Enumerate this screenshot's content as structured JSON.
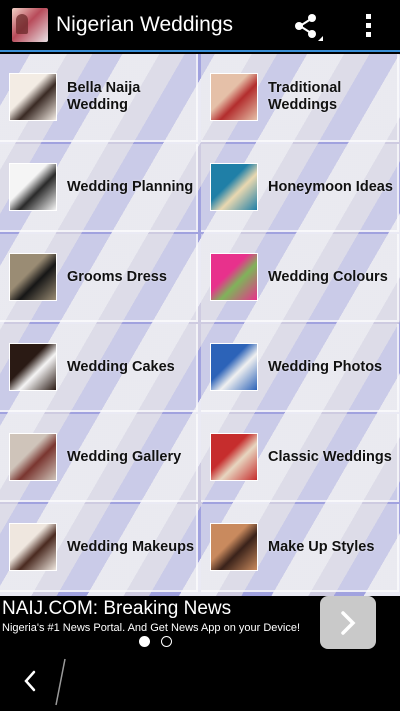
{
  "app": {
    "title": "Nigerian Weddings",
    "icon": "app-logo-icon"
  },
  "toolbar": {
    "share_icon": "share-icon",
    "overflow_icon": "overflow-menu-icon"
  },
  "categories": [
    {
      "label": "Bella Naija Wedding",
      "thumb_colors": [
        "#f3ece4",
        "#3a2a24"
      ]
    },
    {
      "label": "Traditional Weddings",
      "thumb_colors": [
        "#e5c0a8",
        "#b32d2d"
      ]
    },
    {
      "label": "Wedding Planning",
      "thumb_colors": [
        "#f5f5f5",
        "#2a2a2a"
      ]
    },
    {
      "label": "Honeymoon Ideas",
      "thumb_colors": [
        "#1f7fa7",
        "#e9d8b0"
      ]
    },
    {
      "label": "Grooms Dress",
      "thumb_colors": [
        "#9a8c74",
        "#161616"
      ]
    },
    {
      "label": "Wedding Colours",
      "thumb_colors": [
        "#e8318c",
        "#7fb35a"
      ]
    },
    {
      "label": "Wedding Cakes",
      "thumb_colors": [
        "#2a1a14",
        "#f5f5f5"
      ]
    },
    {
      "label": "Wedding Photos",
      "thumb_colors": [
        "#2c63b8",
        "#f0f0f0"
      ]
    },
    {
      "label": "Wedding Gallery",
      "thumb_colors": [
        "#cfc4ba",
        "#7a3630"
      ]
    },
    {
      "label": "Classic Weddings",
      "thumb_colors": [
        "#c62d2d",
        "#e7d6c0"
      ]
    },
    {
      "label": "Wedding Makeups",
      "thumb_colors": [
        "#efe7df",
        "#4a2a20"
      ]
    },
    {
      "label": "Make Up Styles",
      "thumb_colors": [
        "#c98a5e",
        "#3a221a"
      ]
    }
  ],
  "ad": {
    "title": "NAIJ.COM: Breaking News",
    "subtitle": "Nigeria's #1 News Portal. And Get News App on your Device!",
    "arrow_icon": "chevron-right-icon"
  },
  "pager": {
    "active_index": 0,
    "count": 2
  },
  "nav": {
    "back_icon": "back-icon"
  }
}
